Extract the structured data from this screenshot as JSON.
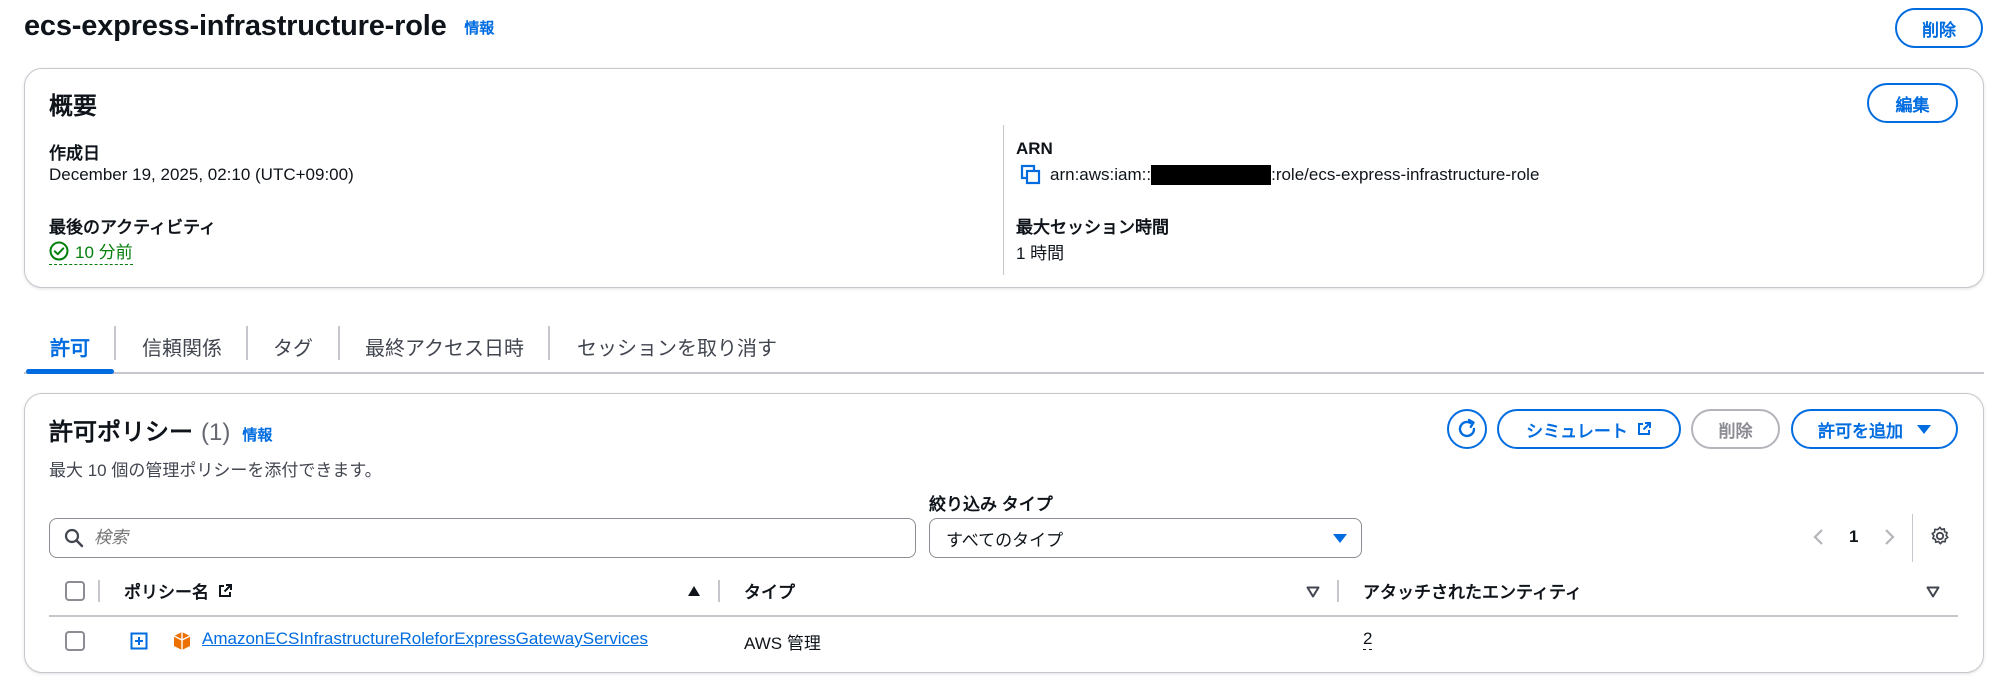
{
  "header": {
    "title": "ecs-express-infrastructure-role",
    "info": "情報",
    "delete": "削除"
  },
  "summary": {
    "title": "概要",
    "edit": "編集",
    "created_label": "作成日",
    "created_value": "December 19, 2025, 02:10 (UTC+09:00)",
    "last_activity_label": "最後のアクティビティ",
    "last_activity_value": "10 分前",
    "arn_label": "ARN",
    "arn_prefix": "arn:aws:iam::",
    "arn_suffix": ":role/ecs-express-infrastructure-role",
    "max_session_label": "最大セッション時間",
    "max_session_value": "1 時間"
  },
  "tabs": [
    {
      "label": "許可"
    },
    {
      "label": "信頼関係"
    },
    {
      "label": "タグ"
    },
    {
      "label": "最終アクセス日時"
    },
    {
      "label": "セッションを取り消す"
    }
  ],
  "policies": {
    "title": "許可ポリシー",
    "count": "(1)",
    "info": "情報",
    "description": "最大 10 個の管理ポリシーを添付できます。",
    "simulate": "シミュレート",
    "delete": "削除",
    "add": "許可を追加",
    "filter_label": "絞り込み タイプ",
    "search_placeholder": "検索",
    "filter_value": "すべてのタイプ",
    "page": "1",
    "columns": {
      "name": "ポリシー名",
      "type": "タイプ",
      "entities": "アタッチされたエンティティ"
    },
    "rows": [
      {
        "name": "AmazonECSInfrastructureRoleforExpressGatewayServices",
        "type": "AWS 管理",
        "entities": "2"
      }
    ]
  },
  "colors": {
    "accent": "#006ce0",
    "success": "#037f0c",
    "aws_orange": "#ed7100"
  }
}
